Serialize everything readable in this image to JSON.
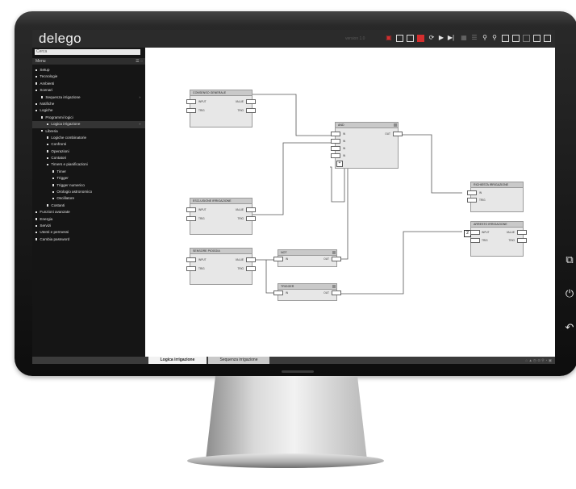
{
  "app": {
    "logo": "delego",
    "version": "version 1.0",
    "search_placeholder": "Cerca",
    "menu_label": "Menu"
  },
  "toolbar": {
    "icons": [
      "save-icon",
      "new-icon",
      "open-icon",
      "stop-icon",
      "refresh-icon",
      "play-icon",
      "step-icon",
      "grid-icon",
      "list-icon",
      "zoom-in-icon",
      "zoom-out-icon",
      "panel-left-icon",
      "panel-bottom-icon",
      "panel-right-icon",
      "fullscreen-icon",
      "close-icon"
    ]
  },
  "sidebar": {
    "items": [
      {
        "label": "Setup",
        "level": 0
      },
      {
        "label": "Tecnologie",
        "level": 0
      },
      {
        "label": "Ambienti",
        "level": 0
      },
      {
        "label": "Scenari",
        "level": 0
      },
      {
        "label": "Sequenza irrigazione",
        "level": 1,
        "arrow": "›"
      },
      {
        "label": "Notifiche",
        "level": 0
      },
      {
        "label": "Logiche",
        "level": 0
      },
      {
        "label": "Programmi logici",
        "level": 1
      },
      {
        "label": "Logica irrigazione",
        "level": 2,
        "active": true,
        "arrow": "›"
      },
      {
        "label": "Libreria",
        "level": 1
      },
      {
        "label": "Logiche combinatorie",
        "level": 2
      },
      {
        "label": "Confronti",
        "level": 2
      },
      {
        "label": "Operazioni",
        "level": 2
      },
      {
        "label": "Contatori",
        "level": 2
      },
      {
        "label": "Timers e pianificazioni",
        "level": 2
      },
      {
        "label": "Timer",
        "level": 3
      },
      {
        "label": "Trigger",
        "level": 3
      },
      {
        "label": "Trigger numerico",
        "level": 3
      },
      {
        "label": "Orologio astronomico",
        "level": 3
      },
      {
        "label": "Oscillatore",
        "level": 3
      },
      {
        "label": "Costanti",
        "level": 2
      },
      {
        "label": "Funzioni avanzate",
        "level": 0
      },
      {
        "label": "Energia",
        "level": 0
      },
      {
        "label": "Servizi",
        "level": 0
      },
      {
        "label": "Utenti e permessi",
        "level": 0
      },
      {
        "label": "Cambia password",
        "level": 0
      }
    ]
  },
  "diagram": {
    "blocks": {
      "consenso": {
        "title": "CONSENSO GENERALE",
        "in": "INPUT",
        "out": "VALUE",
        "in2": "TRIG",
        "out2": "TRIG"
      },
      "and": {
        "title": "AND",
        "in1": "IN",
        "in2": "IN",
        "in3": "IN",
        "in4": "IN",
        "out": "OUT"
      },
      "richiesta": {
        "title": "RICHIESTA IRRIGAZIONE",
        "in": "IN",
        "in2": "TRIG"
      },
      "esclusione": {
        "title": "ESCLUSIONE IRRIGAZIONE",
        "in": "INPUT",
        "out": "VALUE",
        "in2": "TRIG",
        "out2": "TRIG"
      },
      "sensore": {
        "title": "SENSORE PIOGGIA",
        "in": "INPUT",
        "out": "VALUE",
        "in2": "TRIG",
        "out2": "TRIG"
      },
      "not": {
        "title": "NOT",
        "in": "IN",
        "out": "OUT"
      },
      "trigger": {
        "title": "TRIGGER",
        "in": "IN",
        "out": "OUT"
      },
      "arresto": {
        "title": "ARRESTO IRRIGAZIONE",
        "in": "INPUT",
        "out": "VALUE",
        "in2": "TRIG",
        "out2": "TRIG",
        "num": "2"
      }
    }
  },
  "tabs": [
    "Logica irrigazione",
    "Sequenza irrigazione"
  ],
  "status_right": "⌂ ▲ ◷ ⊙ ⚲ ◔ ▣"
}
